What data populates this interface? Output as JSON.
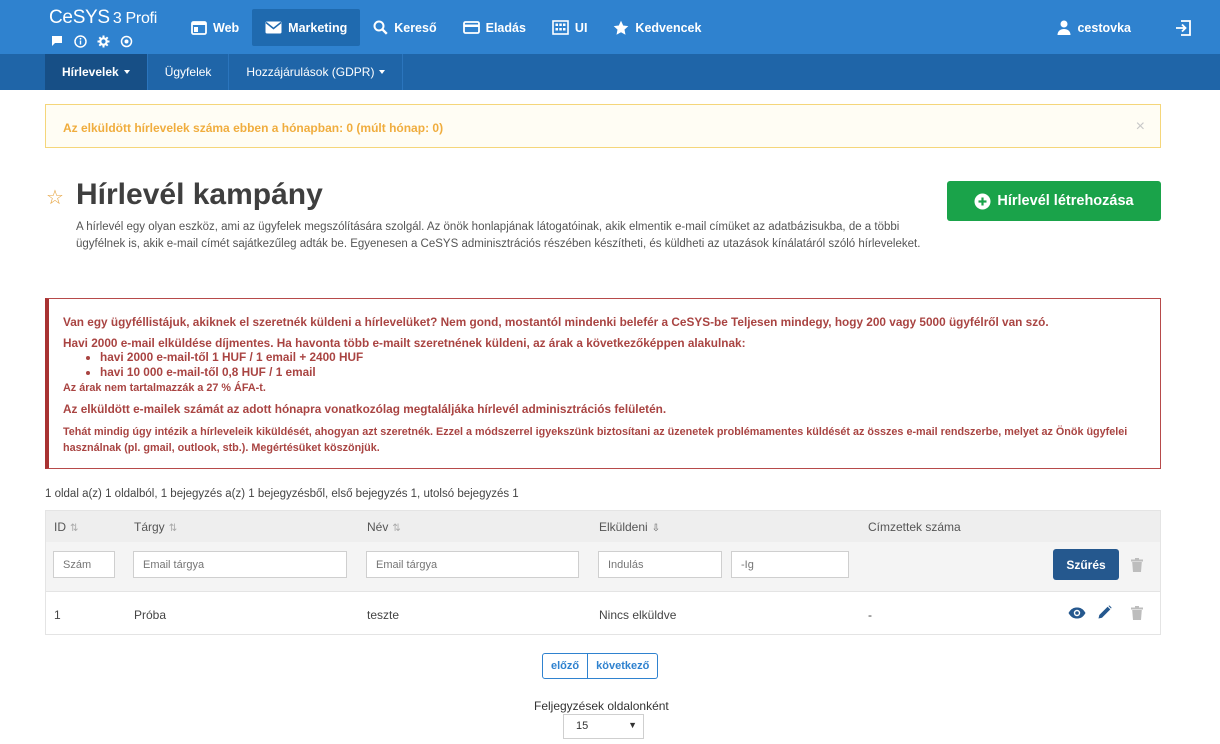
{
  "brand": {
    "name": "CeSYS",
    "version": "3 Profi"
  },
  "nav": {
    "items": [
      {
        "label": "Web",
        "icon": "browser-window-icon"
      },
      {
        "label": "Marketing",
        "icon": "envelope-icon",
        "active": true
      },
      {
        "label": "Kereső",
        "icon": "search-icon"
      },
      {
        "label": "Eladás",
        "icon": "credit-card-icon"
      },
      {
        "label": "UI",
        "icon": "building-icon"
      },
      {
        "label": "Kedvencek",
        "icon": "star-icon"
      }
    ],
    "user": "cestovka"
  },
  "subnav": {
    "items": [
      {
        "label": "Hírlevelek",
        "dropdown": true,
        "active": true
      },
      {
        "label": "Ügyfelek",
        "dropdown": false
      },
      {
        "label": "Hozzájárulások (GDPR)",
        "dropdown": true
      }
    ]
  },
  "alert_warning": {
    "text": "Az elküldött hírlevelek száma ebben a hónapban: 0 (múlt hónap: 0)",
    "close": "×"
  },
  "page": {
    "title": "Hírlevél kampány",
    "description": "A hírlevél egy olyan eszköz, ami az ügyfelek megszólítására szolgál. Az önök honlapjának látogatóinak, akik elmentik e-mail címüket az adatbázisukba, de a többi ügyfélnek is, akik e-mail címét sajátkezűleg adták be. Egyenesen a CeSYS adminisztrációs részében készítheti, és küldheti az utazások kínálatáról szóló hírleveleket.",
    "create_button": "Hírlevél létrehozása"
  },
  "alert_danger": {
    "line1": "Van egy ügyféllistájuk, akiknek el szeretnék küldeni a hírlevelüket? Nem gond, mostantól mindenki belefér a CeSYS-be Teljesen mindegy, hogy 200 vagy 5000 ügyfélről van szó.",
    "line2": "Havi 2000 e-mail elküldése díjmentes. Ha havonta több e-mailt szeretnének küldeni, az árak a következőképpen alakulnak:",
    "prices": [
      "havi 2000 e-mail-től 1 HUF / 1 email + 2400 HUF",
      "havi 10 000 e-mail-től 0,8 HUF / 1 email"
    ],
    "vat": "Az árak nem tartalmazzák a 27 % ÁFA-t.",
    "line5": "Az elküldött e-mailek számát az adott hónapra vonatkozólag megtaláljáka hírlevél adminisztrációs felületén.",
    "line6": "Tehát mindig úgy intézik a hírleveleik kiküldését, ahogyan azt szeretnék. Ezzel a módszerrel igyekszünk biztosítani az üzenetek problémamentes küldését az összes e-mail rendszerbe, melyet az Önök ügyfelei használnak (pl. gmail, outlook, stb.). Megértésüket köszönjük."
  },
  "pager_info": "1 oldal a(z) 1 oldalból, 1 bejegyzés a(z) 1 bejegyzésből, első bejegyzés 1, utolsó bejegyzés 1",
  "table": {
    "columns": [
      "ID",
      "Tárgy",
      "Név",
      "Elküldeni",
      "Címzettek száma"
    ],
    "filters": {
      "id_placeholder": "Szám",
      "subject_placeholder": "Email tárgya",
      "name_placeholder": "Email tárgya",
      "from_placeholder": "Indulás",
      "to_placeholder": "-Ig",
      "filter_button": "Szűrés"
    },
    "rows": [
      {
        "id": "1",
        "subject": "Próba",
        "name": "teszte",
        "send": "Nincs elküldve",
        "recipients": "-"
      }
    ]
  },
  "pagination": {
    "prev": "előző",
    "next": "következő"
  },
  "per_page": {
    "label": "Feljegyzések oldalonként",
    "value": "15"
  }
}
